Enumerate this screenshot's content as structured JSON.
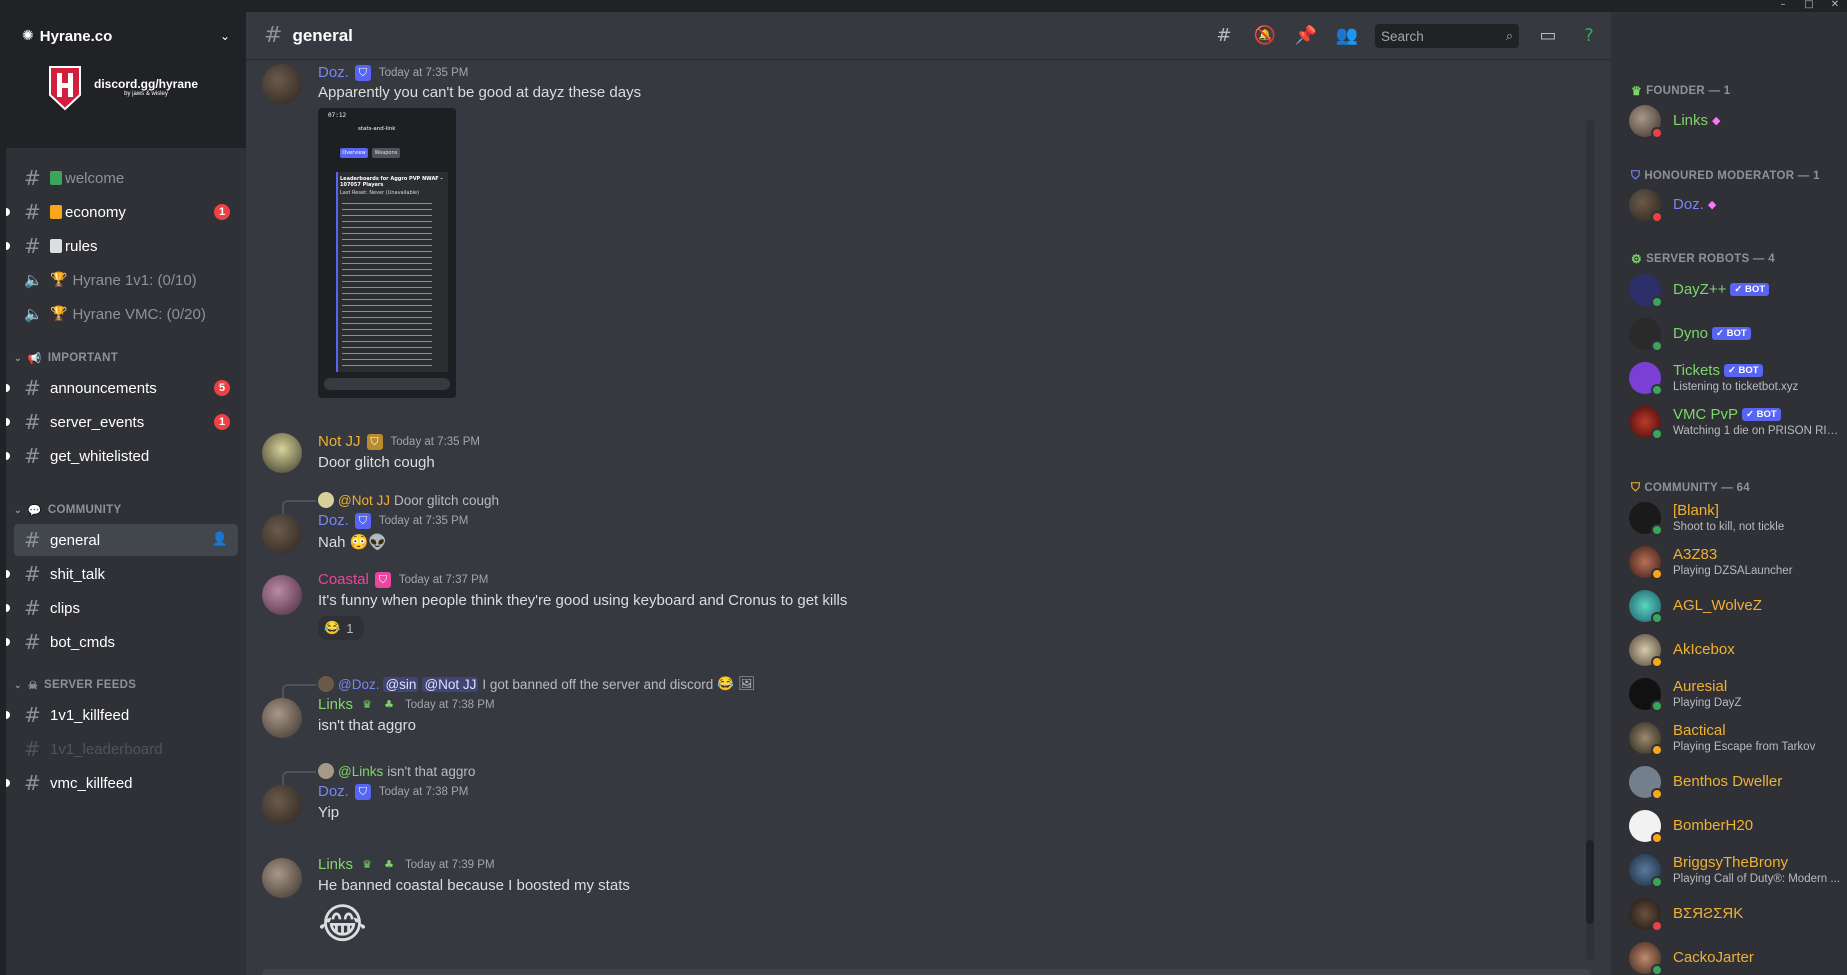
{
  "window": {
    "minimize": "–",
    "maximize": "□",
    "close": "✕"
  },
  "server": {
    "name": "Hyrane.co",
    "banner_title": "discord.gg/hyrane",
    "banner_sub": "by jaws & wisley"
  },
  "channels": {
    "top": [
      {
        "label": "welcome",
        "emoji_color": "#3ba55c"
      },
      {
        "label": "economy",
        "emoji_color": "#faa61a",
        "badge": "1"
      },
      {
        "label": "rules",
        "emoji_color": "#dcddde"
      },
      {
        "label": "Hyrane 1v1: (0/10)",
        "voice": true
      },
      {
        "label": "Hyrane VMC: (0/20)",
        "voice": true
      }
    ],
    "important": {
      "title": "IMPORTANT",
      "items": [
        {
          "label": "announcements",
          "badge": "5"
        },
        {
          "label": "server_events",
          "badge": "1"
        },
        {
          "label": "get_whitelisted"
        }
      ]
    },
    "community": {
      "title": "COMMUNITY",
      "items": [
        {
          "label": "general"
        },
        {
          "label": "shit_talk"
        },
        {
          "label": "clips"
        },
        {
          "label": "bot_cmds"
        }
      ]
    },
    "server_feeds": {
      "title": "SERVER FEEDS",
      "items": [
        {
          "label": "1v1_killfeed"
        },
        {
          "label": "1v1_leaderboard"
        },
        {
          "label": "vmc_killfeed"
        }
      ]
    }
  },
  "header": {
    "channel": "general",
    "search_placeholder": "Search"
  },
  "messages": [
    {
      "author": "Doz.",
      "color": "#7b84f5",
      "time": "Today at 7:35 PM",
      "text": "Apparently you can't be good at dayz these days"
    },
    {
      "author": "Not JJ",
      "color": "#f0b132",
      "time": "Today at 7:35 PM",
      "text": "Door glitch cough"
    },
    {
      "reply_to": "@Not JJ",
      "reply_text": "Door glitch cough",
      "author": "Doz.",
      "color": "#7b84f5",
      "time": "Today at 7:35 PM",
      "text": "Nah"
    },
    {
      "author": "Coastal",
      "color": "#eb459e",
      "time": "Today at 7:37 PM",
      "text": "It's funny when people think they're good using keyboard and Cronus to get kills",
      "reaction_count": "1"
    },
    {
      "reply_to": "@Doz.",
      "reply_mentions": [
        "@sin",
        "@Not JJ"
      ],
      "reply_text": "I got banned off the server and discord",
      "author": "Links",
      "color": "#7fd66b",
      "time": "Today at 7:38 PM",
      "text": "isn't that aggro"
    },
    {
      "reply_to": "@Links",
      "reply_text": "isn't that aggro",
      "author": "Doz.",
      "color": "#7b84f5",
      "time": "Today at 7:38 PM",
      "text": "Yip"
    },
    {
      "author": "Links",
      "color": "#7fd66b",
      "time": "Today at 7:39 PM",
      "text": "He banned coastal because I boosted my stats"
    }
  ],
  "screenshot": {
    "time": "07:12",
    "channel": "stats-and-link",
    "tab1": "Overview",
    "tab2": "Weapons",
    "title": "Leaderboards for Aggro PVP NWAF - 107057 Players",
    "sub": "Last Reset: Never (Unavailable)"
  },
  "member_groups": [
    {
      "title": "FOUNDER — 1",
      "members": [
        {
          "name": "Links",
          "color": "#7fd66b",
          "status": "#ed4245",
          "gem": true
        }
      ]
    },
    {
      "title": "HONOURED MODERATOR — 1",
      "members": [
        {
          "name": "Doz.",
          "color": "#7b84f5",
          "status": "#ed4245",
          "gem": true
        }
      ]
    },
    {
      "title": "SERVER ROBOTS — 4",
      "members": [
        {
          "name": "DayZ++",
          "color": "#7fd66b",
          "status": "#3ba55c",
          "bot": "✓ BOT"
        },
        {
          "name": "Dyno",
          "color": "#7fd66b",
          "status": "#3ba55c",
          "bot": "✓ BOT"
        },
        {
          "name": "Tickets",
          "color": "#7fd66b",
          "status": "#3ba55c",
          "bot": "✓ BOT",
          "activity": "Listening to ticketbot.xyz"
        },
        {
          "name": "VMC PvP",
          "color": "#7fd66b",
          "status": "#3ba55c",
          "bot": "✓ BOT",
          "activity": "Watching 1 die on PRISON RIO..."
        }
      ]
    },
    {
      "title": "COMMUNITY — 64",
      "members": [
        {
          "name": "[Blank]",
          "color": "#f0b132",
          "status": "#3ba55c",
          "activity": "Shoot to kill, not tickle"
        },
        {
          "name": "A3Z83",
          "color": "#f0b132",
          "status": "#faa61a",
          "activity": "Playing DZSALauncher"
        },
        {
          "name": "AGL_WolveZ",
          "color": "#f0b132",
          "status": "#3ba55c"
        },
        {
          "name": "AkIcebox",
          "color": "#f0b132",
          "status": "#faa61a"
        },
        {
          "name": "Auresial",
          "color": "#f0b132",
          "status": "#3ba55c",
          "activity": "Playing DayZ"
        },
        {
          "name": "Bactical",
          "color": "#f0b132",
          "status": "#faa61a",
          "activity": "Playing Escape from Tarkov"
        },
        {
          "name": "Benthos Dweller",
          "color": "#f0b132",
          "status": "#faa61a"
        },
        {
          "name": "BomberH20",
          "color": "#f0b132",
          "status": "#faa61a"
        },
        {
          "name": "BriggsyTheBrony",
          "color": "#f0b132",
          "status": "#3ba55c",
          "activity": "Playing Call of Duty®: Modern ..."
        },
        {
          "name": "BΣЯƧΣЯK",
          "color": "#f0b132",
          "status": "#ed4245"
        },
        {
          "name": "CackoJarter",
          "color": "#f0b132",
          "status": "#3ba55c"
        }
      ]
    }
  ],
  "colors": {
    "bg_main": "#36393f",
    "bg_side": "#2f3136",
    "blurple": "#5865f2",
    "badge": "#ed4245"
  }
}
